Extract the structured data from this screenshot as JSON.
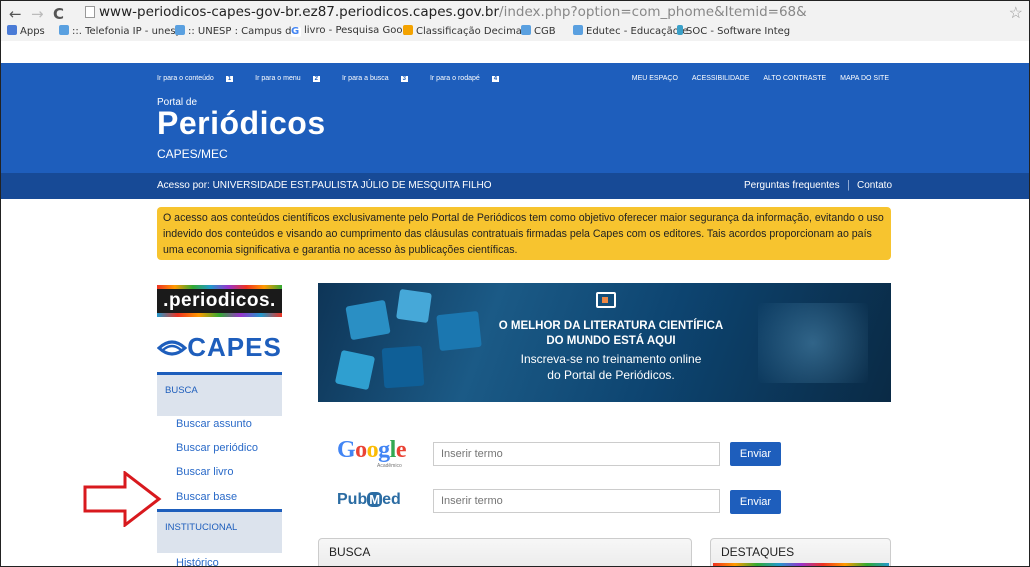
{
  "browser": {
    "url_host": "www-periodicos-capes-gov-br.ez87.periodicos.capes.gov.br",
    "url_path": "/index.php?option=com_phome&Itemid=68&",
    "bookmarks": [
      {
        "label": "Apps",
        "color": "#4a7bd6"
      },
      {
        "label": "::. Telefonia IP - unesp",
        "color": "#5aa0e0"
      },
      {
        "label": ":: UNESP : Campus de",
        "color": "#5aa0e0"
      },
      {
        "label": "livro - Pesquisa Goog",
        "color": "#4285f4"
      },
      {
        "label": "Classificação Decimal",
        "color": "#f4a300"
      },
      {
        "label": "CGB",
        "color": "#5aa0e0"
      },
      {
        "label": "Edutec - Educação e",
        "color": "#5aa0e0"
      },
      {
        "label": "SOC - Software Integ",
        "color": "#3aa0c8"
      }
    ]
  },
  "header": {
    "skip_links": [
      {
        "label": "Ir para o conteúdo",
        "key": "1"
      },
      {
        "label": "Ir para o menu",
        "key": "2"
      },
      {
        "label": "Ir para a busca",
        "key": "3"
      },
      {
        "label": "Ir para o rodapé",
        "key": "4"
      }
    ],
    "top_links": [
      "MEU ESPAÇO",
      "ACESSIBILIDADE",
      "ALTO CONTRASTE",
      "MAPA DO SITE"
    ],
    "portal_de": "Portal de",
    "title": "Periódicos",
    "subtitle": "CAPES/MEC",
    "access_text": "Acesso por: UNIVERSIDADE EST.PAULISTA JÚLIO DE MESQUITA FILHO",
    "faq": "Perguntas frequentes",
    "separator": "|",
    "contact": "Contato"
  },
  "notice": "O acesso aos conteúdos científicos exclusivamente pelo Portal de Periódicos tem como objetivo oferecer maior segurança da informação, evitando o uso indevido dos conteúdos e visando ao cumprimento das cláusulas contratuais firmadas pela Capes com os editores. Tais acordos proporcionam ao país uma economia significativa e garantia no acesso às publicações científicas.",
  "sidebar": {
    "logo_periodicos": ".periodicos.",
    "logo_capes": "CAPES",
    "busca_heading": "BUSCA",
    "busca_links": [
      "Buscar assunto",
      "Buscar periódico",
      "Buscar livro",
      "Buscar base"
    ],
    "institucional_heading": "INSTITUCIONAL",
    "institucional_links": [
      "Histórico"
    ]
  },
  "banner": {
    "headline_1": "O MELHOR DA LITERATURA CIENTÍFICA",
    "headline_2": "DO MUNDO ESTÁ AQUI",
    "sub_1": "Inscreva-se no treinamento online",
    "sub_2": "do Portal de Periódicos."
  },
  "search": {
    "google_logo": "Google",
    "google_sub": "Acadêmico",
    "google_placeholder": "Inserir termo",
    "pubmed_pub": "Pub",
    "pubmed_m": "M",
    "pubmed_ed": "ed",
    "pubmed_placeholder": "Inserir termo",
    "submit_label": "Enviar"
  },
  "panels": {
    "busca_title": "BUSCA",
    "destaques_title": "DESTAQUES"
  }
}
